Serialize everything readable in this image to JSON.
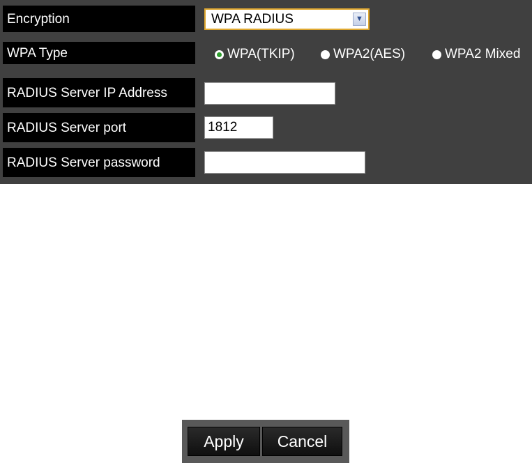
{
  "form": {
    "encryption": {
      "label": "Encryption",
      "selected": "WPA RADIUS"
    },
    "wpa_type": {
      "label": "WPA Type",
      "options": [
        {
          "label": "WPA(TKIP)",
          "checked": true
        },
        {
          "label": "WPA2(AES)",
          "checked": false
        },
        {
          "label": "WPA2 Mixed",
          "checked": false
        }
      ]
    },
    "radius_ip": {
      "label": "RADIUS Server IP Address",
      "value": ""
    },
    "radius_port": {
      "label": "RADIUS Server port",
      "value": "1812"
    },
    "radius_password": {
      "label": "RADIUS Server password",
      "value": ""
    }
  },
  "buttons": {
    "apply": "Apply",
    "cancel": "Cancel"
  },
  "colors": {
    "panel_bg": "#404040",
    "label_bg": "#000000",
    "select_border": "#e0a830",
    "radio_checked": "#2f9f2f"
  }
}
